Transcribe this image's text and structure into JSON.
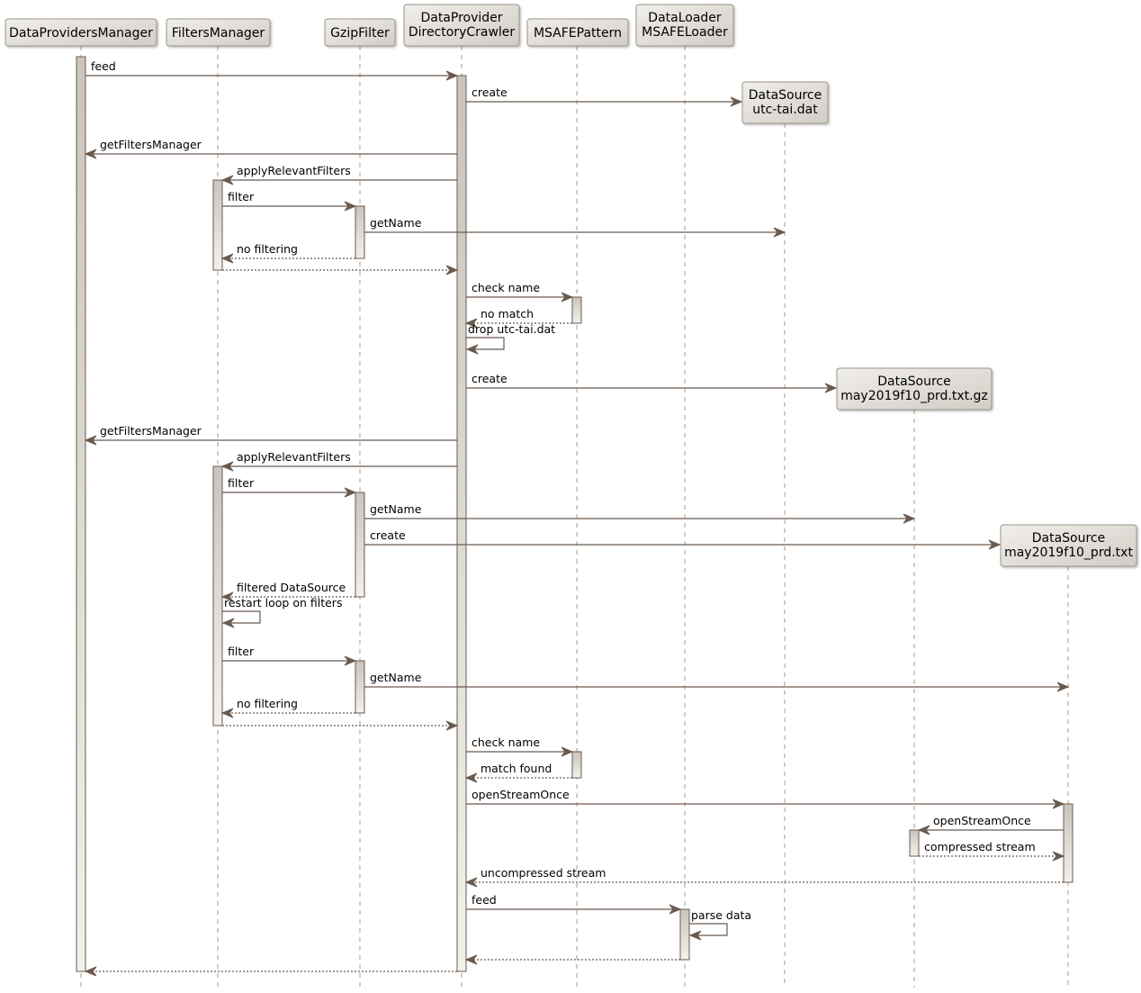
{
  "diagram": {
    "type": "sequence",
    "colors": {
      "line": "#6b5b4f",
      "lifeline": "#a89a8e",
      "box_fill_start": "#f1efeb",
      "box_fill_end": "#d1ccc5",
      "box_border": "#9c948b",
      "activation_start": "#c9c4bd",
      "activation_end": "#f3f0eb",
      "activation_border": "#6b5b4f"
    },
    "participants": [
      {
        "id": "dpm",
        "lines": [
          "DataProvidersManager"
        ]
      },
      {
        "id": "fm",
        "lines": [
          "FiltersManager"
        ]
      },
      {
        "id": "gzip",
        "lines": [
          "GzipFilter"
        ]
      },
      {
        "id": "dc",
        "lines": [
          "DataProvider",
          "DirectoryCrawler"
        ]
      },
      {
        "id": "pat",
        "lines": [
          "MSAFEPattern"
        ]
      },
      {
        "id": "ldr",
        "lines": [
          "DataLoader",
          "MSAFELoader"
        ]
      },
      {
        "id": "ds1",
        "lines": [
          "DataSource",
          "utc-tai.dat"
        ],
        "created": true
      },
      {
        "id": "ds2",
        "lines": [
          "DataSource",
          "may2019f10_prd.txt.gz"
        ],
        "created": true
      },
      {
        "id": "ds3",
        "lines": [
          "DataSource",
          "may2019f10_prd.txt"
        ],
        "created": true
      }
    ],
    "messages": [
      {
        "from": "dpm",
        "to": "dc",
        "label": "feed",
        "style": "sync"
      },
      {
        "from": "dc",
        "to": "ds1",
        "label": "create",
        "style": "create"
      },
      {
        "from": "dc",
        "to": "dpm",
        "label": "getFiltersManager",
        "style": "sync"
      },
      {
        "from": "dc",
        "to": "fm",
        "label": "applyRelevantFilters",
        "style": "sync"
      },
      {
        "from": "fm",
        "to": "gzip",
        "label": "filter",
        "style": "sync"
      },
      {
        "from": "gzip",
        "to": "ds1",
        "label": "getName",
        "style": "sync"
      },
      {
        "from": "gzip",
        "to": "fm",
        "label": "no filtering",
        "style": "return"
      },
      {
        "from": "fm",
        "to": "dc",
        "label": "",
        "style": "return"
      },
      {
        "from": "dc",
        "to": "pat",
        "label": "check name",
        "style": "sync"
      },
      {
        "from": "pat",
        "to": "dc",
        "label": "no match",
        "style": "return"
      },
      {
        "from": "dc",
        "to": "dc",
        "label": "drop utc-tai.dat",
        "style": "self"
      },
      {
        "from": "dc",
        "to": "ds2",
        "label": "create",
        "style": "create"
      },
      {
        "from": "dc",
        "to": "dpm",
        "label": "getFiltersManager",
        "style": "sync"
      },
      {
        "from": "dc",
        "to": "fm",
        "label": "applyRelevantFilters",
        "style": "sync"
      },
      {
        "from": "fm",
        "to": "gzip",
        "label": "filter",
        "style": "sync"
      },
      {
        "from": "gzip",
        "to": "ds2",
        "label": "getName",
        "style": "sync"
      },
      {
        "from": "gzip",
        "to": "ds3",
        "label": "create",
        "style": "create"
      },
      {
        "from": "gzip",
        "to": "fm",
        "label": "filtered DataSource",
        "style": "return"
      },
      {
        "from": "fm",
        "to": "fm",
        "label": "restart loop on filters",
        "style": "self"
      },
      {
        "from": "fm",
        "to": "gzip",
        "label": "filter",
        "style": "sync"
      },
      {
        "from": "gzip",
        "to": "ds3",
        "label": "getName",
        "style": "sync"
      },
      {
        "from": "gzip",
        "to": "fm",
        "label": "no filtering",
        "style": "return"
      },
      {
        "from": "fm",
        "to": "dc",
        "label": "",
        "style": "return"
      },
      {
        "from": "dc",
        "to": "pat",
        "label": "check name",
        "style": "sync"
      },
      {
        "from": "pat",
        "to": "dc",
        "label": "match found",
        "style": "return"
      },
      {
        "from": "dc",
        "to": "ds3",
        "label": "openStreamOnce",
        "style": "sync"
      },
      {
        "from": "ds3",
        "to": "ds2",
        "label": "openStreamOnce",
        "style": "sync"
      },
      {
        "from": "ds2",
        "to": "ds3",
        "label": "compressed stream",
        "style": "return"
      },
      {
        "from": "ds3",
        "to": "dc",
        "label": "uncompressed stream",
        "style": "return"
      },
      {
        "from": "dc",
        "to": "ldr",
        "label": "feed",
        "style": "sync"
      },
      {
        "from": "ldr",
        "to": "ldr",
        "label": "parse data",
        "style": "self"
      },
      {
        "from": "ldr",
        "to": "dc",
        "label": "",
        "style": "return"
      },
      {
        "from": "dc",
        "to": "dpm",
        "label": "",
        "style": "return"
      }
    ]
  }
}
